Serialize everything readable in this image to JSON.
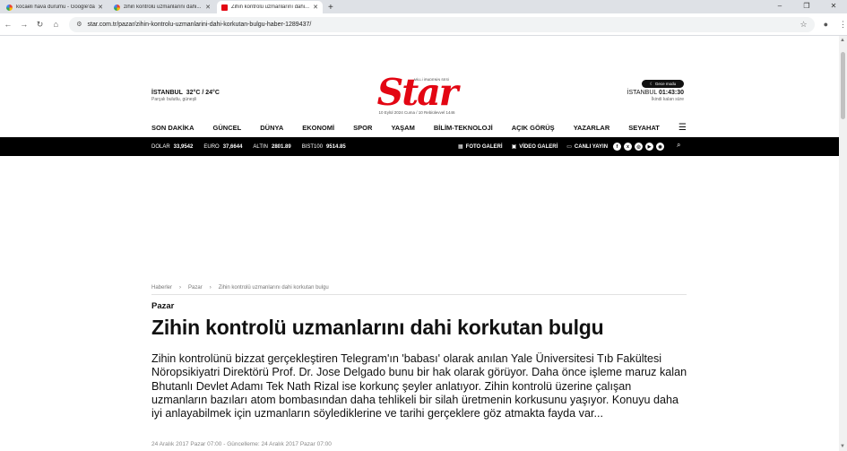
{
  "browser": {
    "tabs": [
      {
        "title": "kocaeli hava durumu - Google'da...",
        "favicon": "google-icon",
        "active": false
      },
      {
        "title": "zihin kontrolü uzmanlarını dahi...",
        "favicon": "google-icon",
        "active": false
      },
      {
        "title": "Zihin kontrolü uzmanlarını dahi...",
        "favicon": "star-site-icon",
        "active": true
      }
    ],
    "new_tab": "+",
    "url": "star.com.tr/pazar/zihin-kontrolu-uzmanlarini-dahi-korkutan-bulgu-haber-1289437/"
  },
  "header": {
    "weather_city": "İSTANBUL",
    "weather_temp": "32°C / 24°C",
    "weather_desc": "Parçalı bulutlu, güneşli",
    "logo_tagline": "MİLLİ İRADENİN SESİ",
    "logo_text": "Star",
    "date_line": "10 Eylül 2024 Cuma / 10 Rebiülevvel 1446",
    "night_mode": "Gece modu",
    "clock_city": "İSTANBUL",
    "clock_time": "01:43:30",
    "clock_desc": "İkindi kalan süre"
  },
  "nav": {
    "items": [
      "SON DAKİKA",
      "GÜNCEL",
      "DÜNYA",
      "EKONOMİ",
      "SPOR",
      "YAŞAM",
      "BİLİM-TEKNOLOJİ",
      "AÇIK GÖRÜŞ",
      "YAZARLAR",
      "SEYAHAT"
    ]
  },
  "markets": [
    {
      "label": "DOLAR",
      "value": "33,9542"
    },
    {
      "label": "EURO",
      "value": "37,6644"
    },
    {
      "label": "ALTIN",
      "value": "2801.89"
    },
    {
      "label": "BIST100",
      "value": "9514.85"
    }
  ],
  "media_links": {
    "photo": "FOTO GALERİ",
    "video": "VİDEO GALERİ",
    "live": "CANLI YAYIN"
  },
  "breadcrumb": {
    "home": "Haberler",
    "section": "Pazar",
    "current": "Zihin kontrolü uzmanlarını dahi korkutan bulgu"
  },
  "article": {
    "category": "Pazar",
    "title": "Zihin kontrolü uzmanlarını dahi korkutan bulgu",
    "summary": "Zihin kontrolünü bizzat gerçekleştiren Telegram'ın 'babası' olarak anılan Yale Üniversitesi Tıb Fakültesi Nöropsikiyatri Direktörü Prof. Dr. Jose Delgado bunu bir hak olarak görüyor. Daha önce işleme maruz kalan Bhutanlı Devlet Adamı Tek Nath Rizal ise korkunç şeyler anlatıyor. Zihin kontrolü üzerine çalışan uzmanların bazıları atom bombasından daha tehlikeli bir silah üretmenin korkusunu yaşıyor. Konuyu daha iyi anlayabilmek için uzmanların söylediklerine ve tarihi gerçeklere göz atmakta fayda var...",
    "dates": "24 Aralık 2017 Pazar 07:00 - Güncelleme: 24 Aralık 2017 Pazar 07:00"
  },
  "colors": {
    "brand_red": "#e30613",
    "bar_black": "#000000"
  }
}
